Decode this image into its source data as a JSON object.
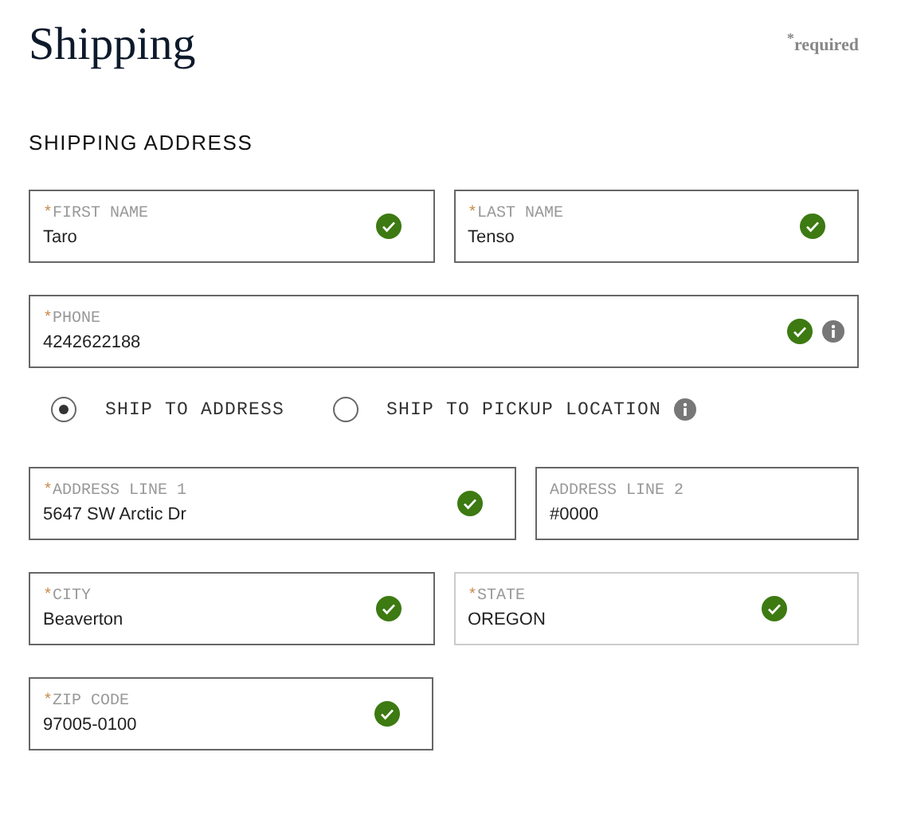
{
  "title": "Shipping",
  "required_note": "$^{*}$required",
  "section_title": "SHIPPING ADDRESS",
  "rows": [
    {
      "kind": "halves",
      "fields": [
        {
          "label": "FIRST NAME",
          "marker": "*",
          "value": "Taro",
          "valid": true,
          "info": false,
          "kind": "text"
        },
        {
          "label": "LAST NAME",
          "marker": "*",
          "value": "Tenso",
          "valid": true,
          "info": false,
          "kind": "text"
        }
      ]
    },
    {
      "kind": "full",
      "fields": [
        {
          "label": "PHONE",
          "marker": "*",
          "value": "4242622188",
          "valid": true,
          "info": true,
          "kind": "text"
        }
      ]
    }
  ],
  "delivery_options": [
    {
      "label": "SHIP TO ADDRESS",
      "selected": true,
      "info": false
    },
    {
      "label": "SHIP TO PICKUP LOCATION",
      "selected": false,
      "info": true
    }
  ],
  "address_rows": [
    {
      "kind": "wide_left",
      "fields": [
        {
          "label": "ADDRESS LINE 1",
          "marker": "*",
          "value": "5647 SW Arctic Dr",
          "valid": true,
          "info": false,
          "kind": "text"
        },
        {
          "label": "ADDRESS LINE 2",
          "value": "#0000",
          "valid": false,
          "info": false,
          "kind": "text"
        }
      ]
    },
    {
      "kind": "halves",
      "fields": [
        {
          "label": "CITY",
          "marker": "*",
          "value": "Beaverton",
          "valid": true,
          "info": false,
          "kind": "text"
        },
        {
          "label": "STATE",
          "marker": "*",
          "value": "OREGON",
          "valid": true,
          "info": false,
          "kind": "select"
        }
      ]
    },
    {
      "kind": "half",
      "fields": [
        {
          "label": "ZIP CODE",
          "marker": "*",
          "value": "97005-0100",
          "valid": true,
          "info": false,
          "kind": "text"
        }
      ]
    }
  ]
}
